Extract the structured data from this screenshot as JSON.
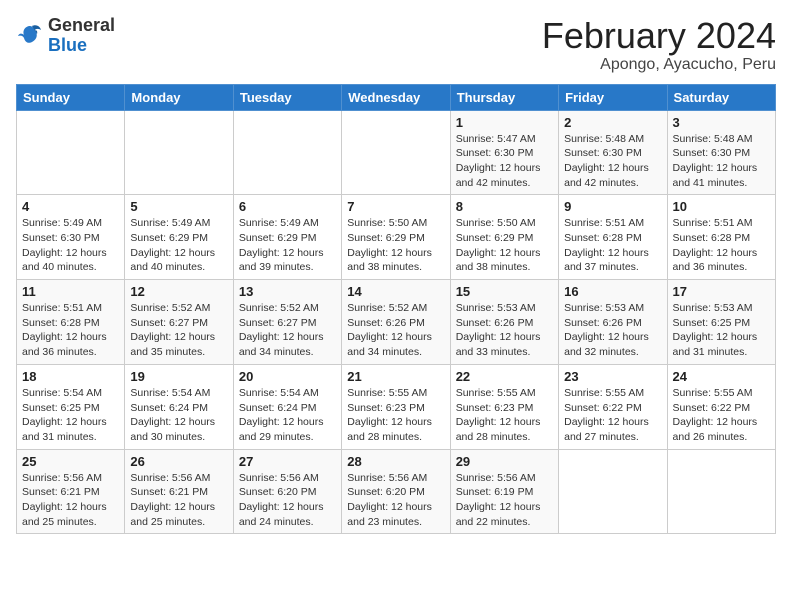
{
  "header": {
    "logo_general": "General",
    "logo_blue": "Blue",
    "title": "February 2024",
    "subtitle": "Apongo, Ayacucho, Peru"
  },
  "calendar": {
    "days_of_week": [
      "Sunday",
      "Monday",
      "Tuesday",
      "Wednesday",
      "Thursday",
      "Friday",
      "Saturday"
    ],
    "weeks": [
      [
        {
          "day": "",
          "info": ""
        },
        {
          "day": "",
          "info": ""
        },
        {
          "day": "",
          "info": ""
        },
        {
          "day": "",
          "info": ""
        },
        {
          "day": "1",
          "info": "Sunrise: 5:47 AM\nSunset: 6:30 PM\nDaylight: 12 hours\nand 42 minutes."
        },
        {
          "day": "2",
          "info": "Sunrise: 5:48 AM\nSunset: 6:30 PM\nDaylight: 12 hours\nand 42 minutes."
        },
        {
          "day": "3",
          "info": "Sunrise: 5:48 AM\nSunset: 6:30 PM\nDaylight: 12 hours\nand 41 minutes."
        }
      ],
      [
        {
          "day": "4",
          "info": "Sunrise: 5:49 AM\nSunset: 6:30 PM\nDaylight: 12 hours\nand 40 minutes."
        },
        {
          "day": "5",
          "info": "Sunrise: 5:49 AM\nSunset: 6:29 PM\nDaylight: 12 hours\nand 40 minutes."
        },
        {
          "day": "6",
          "info": "Sunrise: 5:49 AM\nSunset: 6:29 PM\nDaylight: 12 hours\nand 39 minutes."
        },
        {
          "day": "7",
          "info": "Sunrise: 5:50 AM\nSunset: 6:29 PM\nDaylight: 12 hours\nand 38 minutes."
        },
        {
          "day": "8",
          "info": "Sunrise: 5:50 AM\nSunset: 6:29 PM\nDaylight: 12 hours\nand 38 minutes."
        },
        {
          "day": "9",
          "info": "Sunrise: 5:51 AM\nSunset: 6:28 PM\nDaylight: 12 hours\nand 37 minutes."
        },
        {
          "day": "10",
          "info": "Sunrise: 5:51 AM\nSunset: 6:28 PM\nDaylight: 12 hours\nand 36 minutes."
        }
      ],
      [
        {
          "day": "11",
          "info": "Sunrise: 5:51 AM\nSunset: 6:28 PM\nDaylight: 12 hours\nand 36 minutes."
        },
        {
          "day": "12",
          "info": "Sunrise: 5:52 AM\nSunset: 6:27 PM\nDaylight: 12 hours\nand 35 minutes."
        },
        {
          "day": "13",
          "info": "Sunrise: 5:52 AM\nSunset: 6:27 PM\nDaylight: 12 hours\nand 34 minutes."
        },
        {
          "day": "14",
          "info": "Sunrise: 5:52 AM\nSunset: 6:26 PM\nDaylight: 12 hours\nand 34 minutes."
        },
        {
          "day": "15",
          "info": "Sunrise: 5:53 AM\nSunset: 6:26 PM\nDaylight: 12 hours\nand 33 minutes."
        },
        {
          "day": "16",
          "info": "Sunrise: 5:53 AM\nSunset: 6:26 PM\nDaylight: 12 hours\nand 32 minutes."
        },
        {
          "day": "17",
          "info": "Sunrise: 5:53 AM\nSunset: 6:25 PM\nDaylight: 12 hours\nand 31 minutes."
        }
      ],
      [
        {
          "day": "18",
          "info": "Sunrise: 5:54 AM\nSunset: 6:25 PM\nDaylight: 12 hours\nand 31 minutes."
        },
        {
          "day": "19",
          "info": "Sunrise: 5:54 AM\nSunset: 6:24 PM\nDaylight: 12 hours\nand 30 minutes."
        },
        {
          "day": "20",
          "info": "Sunrise: 5:54 AM\nSunset: 6:24 PM\nDaylight: 12 hours\nand 29 minutes."
        },
        {
          "day": "21",
          "info": "Sunrise: 5:55 AM\nSunset: 6:23 PM\nDaylight: 12 hours\nand 28 minutes."
        },
        {
          "day": "22",
          "info": "Sunrise: 5:55 AM\nSunset: 6:23 PM\nDaylight: 12 hours\nand 28 minutes."
        },
        {
          "day": "23",
          "info": "Sunrise: 5:55 AM\nSunset: 6:22 PM\nDaylight: 12 hours\nand 27 minutes."
        },
        {
          "day": "24",
          "info": "Sunrise: 5:55 AM\nSunset: 6:22 PM\nDaylight: 12 hours\nand 26 minutes."
        }
      ],
      [
        {
          "day": "25",
          "info": "Sunrise: 5:56 AM\nSunset: 6:21 PM\nDaylight: 12 hours\nand 25 minutes."
        },
        {
          "day": "26",
          "info": "Sunrise: 5:56 AM\nSunset: 6:21 PM\nDaylight: 12 hours\nand 25 minutes."
        },
        {
          "day": "27",
          "info": "Sunrise: 5:56 AM\nSunset: 6:20 PM\nDaylight: 12 hours\nand 24 minutes."
        },
        {
          "day": "28",
          "info": "Sunrise: 5:56 AM\nSunset: 6:20 PM\nDaylight: 12 hours\nand 23 minutes."
        },
        {
          "day": "29",
          "info": "Sunrise: 5:56 AM\nSunset: 6:19 PM\nDaylight: 12 hours\nand 22 minutes."
        },
        {
          "day": "",
          "info": ""
        },
        {
          "day": "",
          "info": ""
        }
      ]
    ]
  }
}
